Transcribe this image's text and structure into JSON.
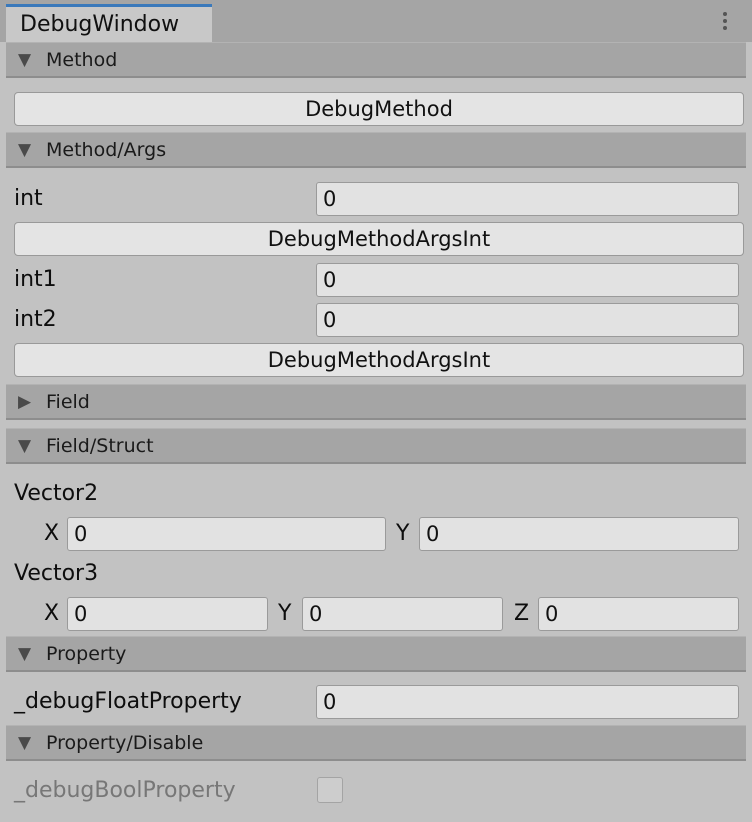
{
  "window": {
    "tab_title": "DebugWindow"
  },
  "sections": {
    "method": {
      "label": "Method",
      "expanded": true
    },
    "method_args": {
      "label": "Method/Args",
      "expanded": true
    },
    "field": {
      "label": "Field",
      "expanded": false
    },
    "field_struct": {
      "label": "Field/Struct",
      "expanded": true
    },
    "property": {
      "label": "Property",
      "expanded": true
    },
    "property_disable": {
      "label": "Property/Disable",
      "expanded": true
    }
  },
  "method": {
    "button": "DebugMethod"
  },
  "method_args": {
    "int_label": "int",
    "int_value": "0",
    "button1": "DebugMethodArgsInt",
    "int1_label": "int1",
    "int1_value": "0",
    "int2_label": "int2",
    "int2_value": "0",
    "button2": "DebugMethodArgsInt"
  },
  "field_struct": {
    "vector2_label": "Vector2",
    "v2_x_label": "X",
    "v2_x_value": "0",
    "v2_y_label": "Y",
    "v2_y_value": "0",
    "vector3_label": "Vector3",
    "v3_x_label": "X",
    "v3_x_value": "0",
    "v3_y_label": "Y",
    "v3_y_value": "0",
    "v3_z_label": "Z",
    "v3_z_value": "0"
  },
  "property": {
    "float_label": "_debugFloatProperty",
    "float_value": "0"
  },
  "property_disable": {
    "bool_label": "_debugBoolProperty",
    "bool_value": false
  },
  "glyphs": {
    "expanded": "▼",
    "collapsed": "▶"
  },
  "colors": {
    "tab_accent": "#3a79bb",
    "header_bg": "#a5a5a5",
    "panel_bg": "#c2c2c2"
  }
}
